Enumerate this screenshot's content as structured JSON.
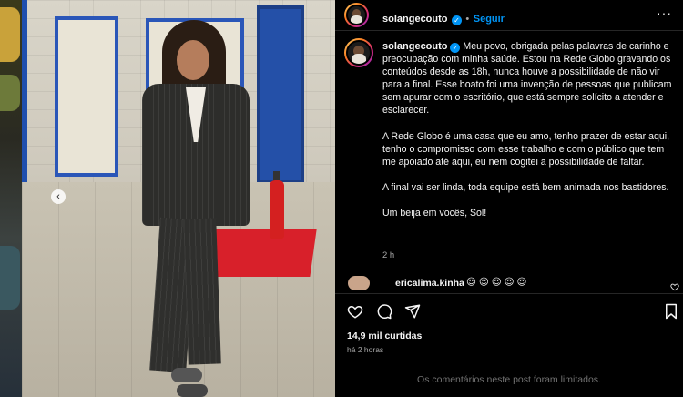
{
  "post": {
    "username": "solangecouto",
    "verified_mark": "✓",
    "separator": "•",
    "follow_label": "Seguir",
    "more_label": "···",
    "caption_paragraphs": [
      "Meu povo, obrigada pelas palavras de carinho e preocupação com minha saúde. Estou na Rede Globo gravando os conteúdos desde as 18h, nunca houve a possibilidade de não vir para a final. Esse boato foi uma invenção de pessoas que publicam sem apurar com o escritório, que está sempre solícito a atender e esclarecer.",
      "A Rede Globo é uma casa que eu amo, tenho prazer de estar aqui, tenho o compromisso com esse trabalho e com o público que tem me apoiado até aqui, eu nem cogitei a possibilidade de faltar.",
      "A final vai ser linda, toda equipe está bem animada nos bastidores.",
      "Um beija em vocês, Sol!"
    ],
    "caption_time": "2 h"
  },
  "comment": {
    "username": "ericalima.kinha",
    "text": "😍 😍 😍 😍 😍"
  },
  "stats": {
    "likes": "14,9 mil curtidas",
    "posted_ago": "há 2 horas"
  },
  "footer": {
    "comments_limited": "Os comentários neste post foram limitados."
  },
  "icons": [
    "heart-icon",
    "comment-icon",
    "share-icon",
    "bookmark-icon",
    "more-options-icon",
    "carousel-prev-icon",
    "verified-icon"
  ],
  "carousel": {
    "prev_arrow": "‹"
  },
  "colors": {
    "background": "#000000",
    "text": "#f5f5f5",
    "muted": "#a8a8a8",
    "accent": "#0095f6",
    "divider": "#262626"
  }
}
